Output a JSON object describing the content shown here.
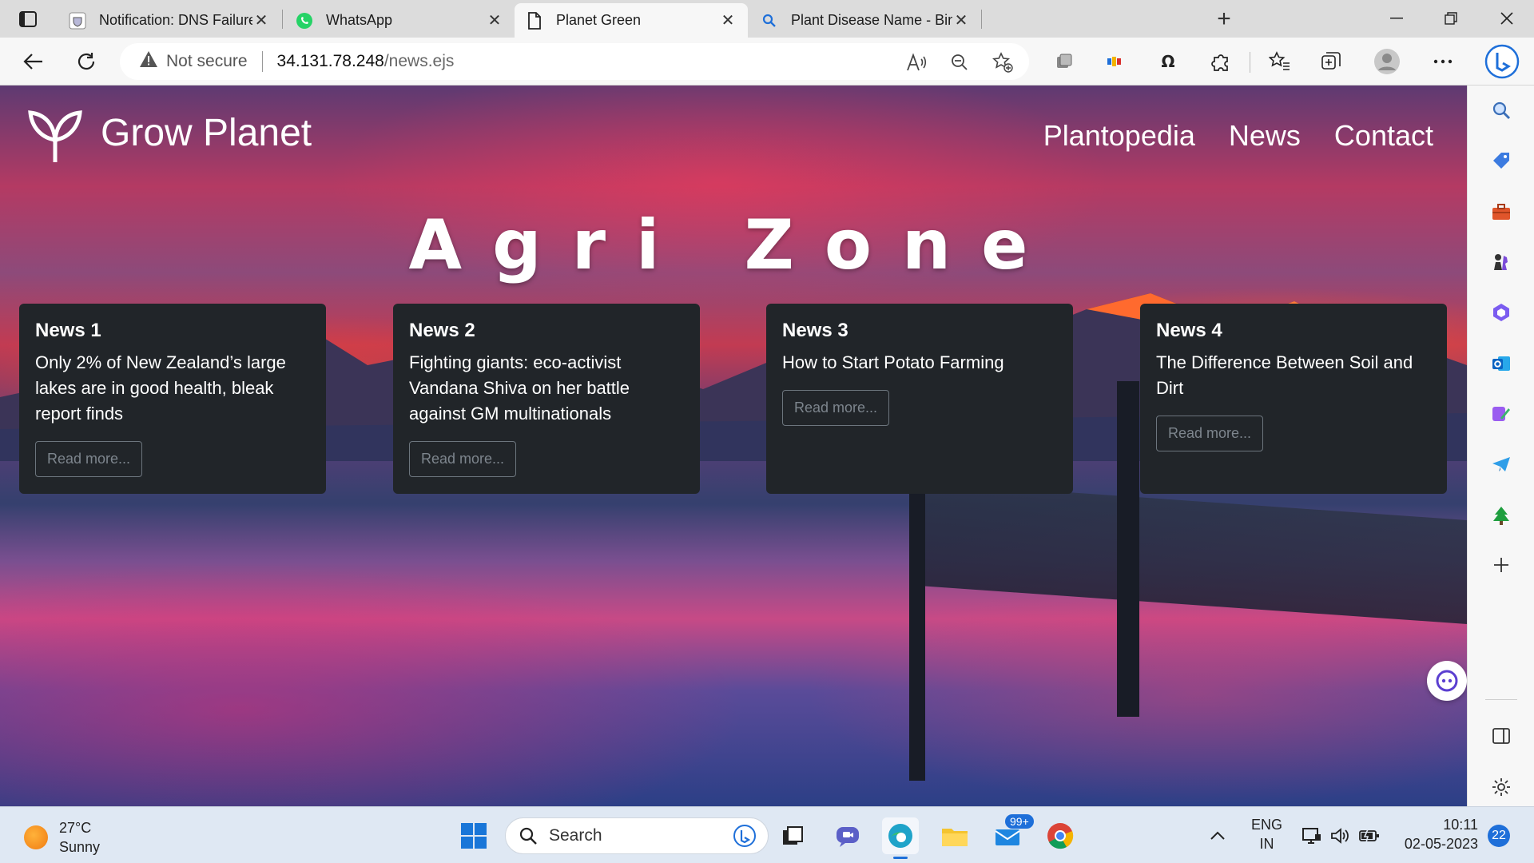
{
  "browser": {
    "tabs": [
      {
        "title": "Notification: DNS Failure",
        "icon": "shield-favicon-icon",
        "active": false
      },
      {
        "title": "WhatsApp",
        "icon": "whatsapp-icon",
        "active": false
      },
      {
        "title": "Planet Green",
        "icon": "page-icon",
        "active": true
      },
      {
        "title": "Plant Disease Name - Bing images",
        "icon": "bing-search-icon",
        "active": false
      }
    ],
    "address": {
      "security_label": "Not secure",
      "url_host": "34.131.78.248",
      "url_path": "/news.ejs"
    }
  },
  "site": {
    "title": "Grow Planet",
    "nav": [
      {
        "label": "Plantopedia"
      },
      {
        "label": "News"
      },
      {
        "label": "Contact"
      }
    ],
    "hero": "Agri Zone",
    "cards": [
      {
        "title": "News 1",
        "text": "Only 2% of New Zealand’s large lakes are in good health, bleak report finds",
        "button": "Read more..."
      },
      {
        "title": "News 2",
        "text": "Fighting giants: eco-activist Vandana Shiva on her battle against GM multinationals",
        "button": "Read more..."
      },
      {
        "title": "News 3",
        "text": "How to Start Potato Farming",
        "button": "Read more..."
      },
      {
        "title": "News 4",
        "text": "The Difference Between Soil and Dirt",
        "button": "Read more..."
      }
    ]
  },
  "taskbar": {
    "weather": {
      "temp": "27°C",
      "condition": "Sunny"
    },
    "search_label": "Search",
    "mail_badge": "99+",
    "language": {
      "line1": "ENG",
      "line2": "IN"
    },
    "clock": {
      "time": "10:11",
      "date": "02-05-2023"
    },
    "notification_count": "22"
  },
  "colors": {
    "card_bg": "#212529",
    "button_border": "#6c757d",
    "accent": "#1e6fd9"
  }
}
